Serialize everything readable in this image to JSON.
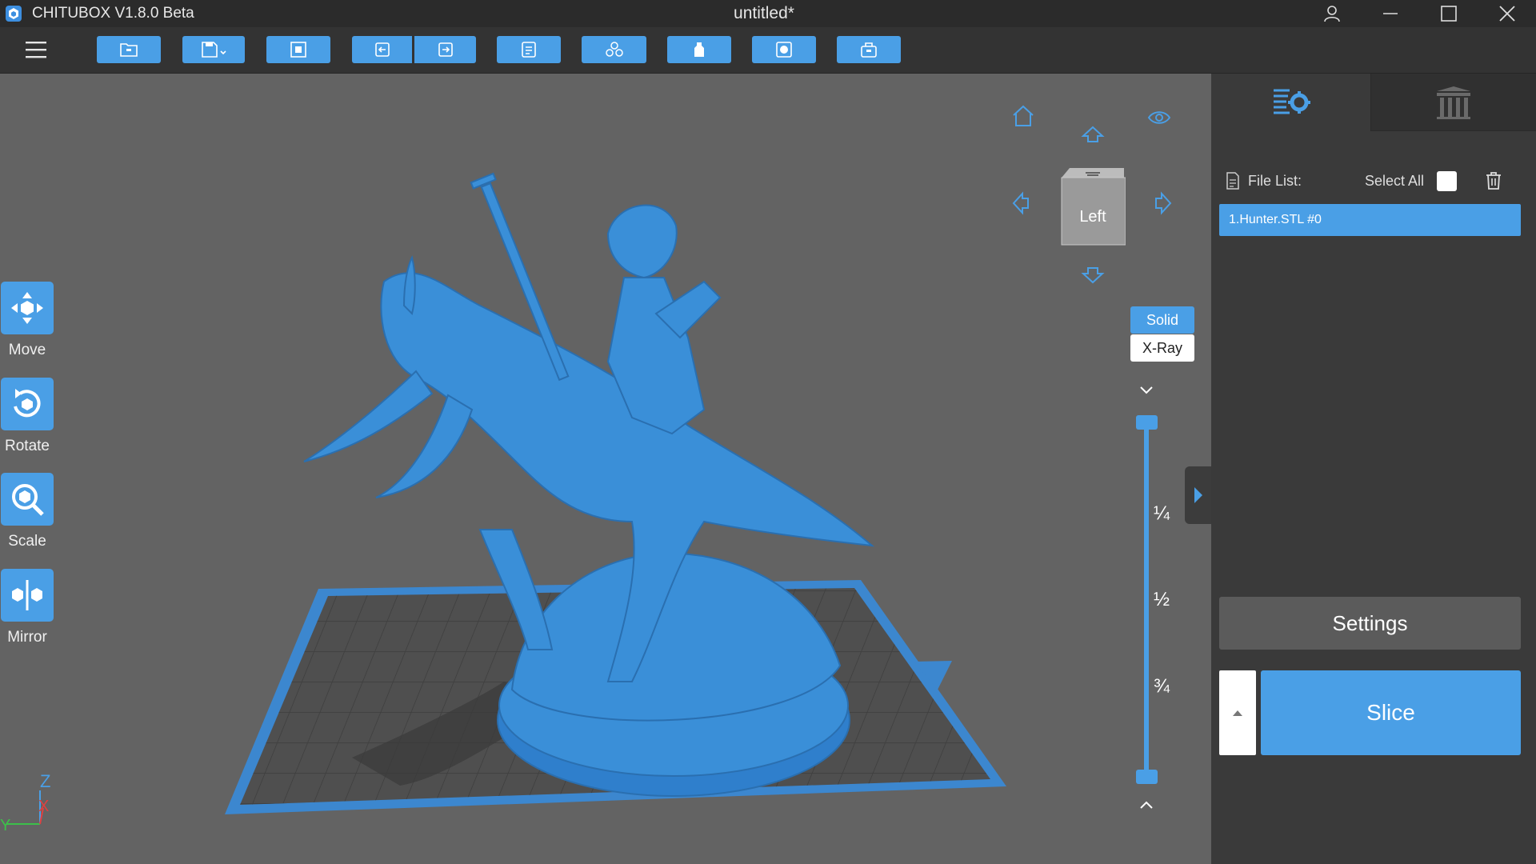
{
  "window": {
    "app_name": "CHITUBOX V1.8.0 Beta",
    "doc_title": "untitled*",
    "controls": [
      "user-icon",
      "minimize-icon",
      "maximize-icon",
      "close-icon"
    ]
  },
  "toolbar": {
    "menu_icon": "hamburger-icon",
    "buttons": [
      "open-file-icon",
      "save-icon",
      "auto-layout-icon",
      "undo-icon",
      "redo-icon",
      "file-icon",
      "copy-models-icon",
      "hollow-icon",
      "dig-hole-icon",
      "print-icon"
    ]
  },
  "tools": {
    "move": "Move",
    "rotate": "Rotate",
    "scale": "Scale",
    "mirror": "Mirror"
  },
  "viewcube": {
    "face": "Left"
  },
  "render_modes": {
    "solid": "Solid",
    "xray": "X-Ray"
  },
  "slider": {
    "marks": [
      "¼",
      "½",
      "¾"
    ]
  },
  "panel": {
    "file_list_label": "File List:",
    "select_all_label": "Select All",
    "files": [
      "1.Hunter.STL #0"
    ],
    "settings_label": "Settings",
    "slice_label": "Slice"
  },
  "axes": {
    "z": "Z",
    "x": "X",
    "y": "Y"
  },
  "colors": {
    "accent": "#4a9fe6",
    "viewport": "#636363",
    "model": "#3a8fd8",
    "panel": "#3a3a3a"
  }
}
